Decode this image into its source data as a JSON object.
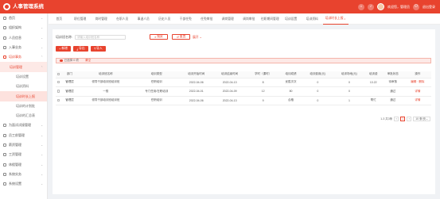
{
  "header": {
    "title": "人事管理系统",
    "welcome": "欢迎您，管理员",
    "logout": "退出登录",
    "icons": [
      "home-icon",
      "bell-icon",
      "avatar"
    ]
  },
  "sidebar": {
    "items": [
      {
        "label": "首页",
        "type": "top"
      },
      {
        "label": "组织架构",
        "type": "top"
      },
      {
        "label": "人员信息",
        "type": "top"
      },
      {
        "label": "入事业务",
        "type": "top"
      },
      {
        "label": "培训事务",
        "type": "parent-active"
      },
      {
        "label": "培训管理",
        "type": "sub1"
      },
      {
        "label": "培训设置",
        "type": "sub2"
      },
      {
        "label": "培训资料",
        "type": "sub2"
      },
      {
        "label": "培训时长上报",
        "type": "sub2-active"
      },
      {
        "label": "培训的计划批",
        "type": "sub2"
      },
      {
        "label": "培训的汇总表",
        "type": "sub2"
      },
      {
        "label": "为面试试接管理",
        "type": "top"
      },
      {
        "label": "员工前管理",
        "type": "top"
      },
      {
        "label": "薪资管理",
        "type": "top"
      },
      {
        "label": "工资管理",
        "type": "top"
      },
      {
        "label": "休假管理",
        "type": "top"
      },
      {
        "label": "系统实务",
        "type": "top"
      },
      {
        "label": "系统设置",
        "type": "top"
      }
    ]
  },
  "tabs": [
    {
      "label": "首页"
    },
    {
      "label": "职位管理"
    },
    {
      "label": "岗时管理"
    },
    {
      "label": "在职人员"
    },
    {
      "label": "事退人员"
    },
    {
      "label": "历史人员"
    },
    {
      "label": "干部任免"
    },
    {
      "label": "任免审批"
    },
    {
      "label": "调岗管理"
    },
    {
      "label": "调岗审批"
    },
    {
      "label": "往职期间管理"
    },
    {
      "label": "培训设置"
    },
    {
      "label": "培训资料"
    },
    {
      "label": "培训时长上报",
      "active": true
    }
  ],
  "search": {
    "label": "培训班名称:",
    "placeholder": "请输入培训班名称",
    "search_label": "搜索",
    "reset_label": "重置",
    "expand_label": "展开"
  },
  "toolbar": {
    "add_label": "新增",
    "export_label": "导出",
    "import_label": "导入"
  },
  "notice": {
    "text": "已选择 0 项",
    "clear": "清空"
  },
  "table": {
    "columns": [
      "部门",
      "培训班名称",
      "培训类型",
      "培训开始时间",
      "培训结束时间",
      "学时（课时）",
      "培训成绩",
      "培训费用(元)",
      "培训场地(元)",
      "培训费",
      "审批状态",
      "操作"
    ],
    "rows": [
      [
        "管理层",
        "领导干部培训班培训班",
        "任职培训",
        "2022-04-06",
        "2022-04-13",
        "8",
        "优胜次次",
        "0",
        "0",
        "13.22",
        "待审核",
        "编辑 · 删除"
      ],
      [
        "管理层",
        "一般",
        "专门任用/在职培训",
        "2022-04-01",
        "2022-04-09",
        "12",
        "80",
        "0",
        "0",
        "",
        "通过",
        "详情"
      ],
      [
        "管理层",
        "领导干部培训班培训班",
        "任职培训",
        "2022-04-06",
        "2022-04-13",
        "9",
        "合格",
        "0",
        "1",
        "帮忙",
        "通过",
        "详情"
      ]
    ]
  },
  "pager": {
    "total": "1-3 共3条",
    "prev": "‹",
    "page": "1",
    "next": "›",
    "page_size": "10 条/页"
  },
  "colors": {
    "accent": "#e8432e",
    "sidebar_active_bg": "#fde2de"
  }
}
